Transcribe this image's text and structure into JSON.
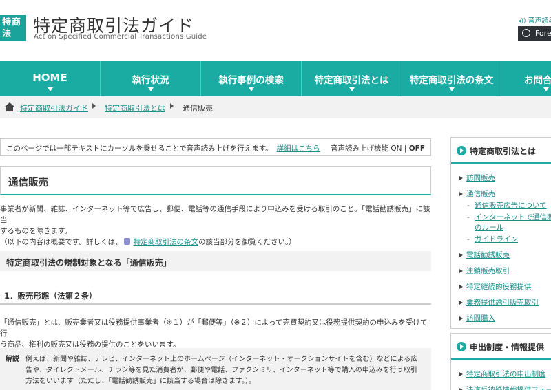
{
  "header": {
    "logo_line1": "特商",
    "logo_line2": "法",
    "title": "特定商取引法ガイド",
    "subtitle": "Act on Specified Commercial Transactions Guide",
    "audio_link": "音声読み",
    "foreign_label": "Fore"
  },
  "nav": {
    "items": [
      {
        "label": "HOME"
      },
      {
        "label": "執行状況"
      },
      {
        "label": "執行事例の検索"
      },
      {
        "label": "特定商取引法とは"
      },
      {
        "label": "特定商取引法の条文"
      },
      {
        "label": "お問合"
      }
    ]
  },
  "breadcrumb": {
    "link1": "特定商取引法ガイド",
    "link2": "特定商取引法とは",
    "current": "通信販売"
  },
  "speech": {
    "message": "このページでは一部テキストにカーソルを乗せることで音声読み上げを行えます。",
    "details_link": "詳細はこちら",
    "toggle_prefix": "音声読み上げ機能 ON",
    "toggle_sep": "|",
    "toggle_off": "OFF"
  },
  "main": {
    "title": "通信販売",
    "intro_line1": "事業者が新聞、雑誌、インターネット等で広告し、郵便、電話等の通信手段により申込みを受ける取引のこと。「電話勧誘販売」に該当",
    "intro_line2": "するものを除きます。",
    "intro_line3_pre": "（以下の内容は概要です。詳しくは、",
    "intro_link": "特定商取引法の条文",
    "intro_line3_post": "の該当部分を御覧ください。）",
    "section_heading": "特定商取引法の規制対象となる「通信販売」",
    "sub_heading": "1．販売形態（法第２条）",
    "para_line1": "「通信販売」とは、販売業者又は役務提供事業者（※１）が「郵便等」（※２）によって売買契約又は役務提供契約の申込みを受けて行",
    "para_line2": "う商品、権利の販売又は役務の提供のことをいいます。",
    "note_label": "解説",
    "note_line1": "例えば、新聞や雑誌、テレビ、インターネット上のホームページ（インターネット・オークションサイトを含む）などによる広",
    "note_line2": "告や、ダイレクトメール、チラシ等を見た消費者が、郵便や電話、ファクシミリ、インターネット等で購入の申込みを行う取引",
    "note_line3": "方法をいいます（ただし、「電話勧誘販売」に該当する場合は除きます。）。"
  },
  "sidebar": {
    "box1_title": "特定商取引法とは",
    "box1_items": [
      {
        "label": "訪問販売",
        "type": "main"
      },
      {
        "label": "通信販売",
        "type": "main"
      },
      {
        "label": "通信販売広告について",
        "type": "sub"
      },
      {
        "label": "インターネットで通信販売のルール",
        "type": "sub"
      },
      {
        "label": "ガイドライン",
        "type": "sub"
      },
      {
        "label": "電話勧誘販売",
        "type": "main"
      },
      {
        "label": "連鎖販売取引",
        "type": "main"
      },
      {
        "label": "特定継続的役務提供",
        "type": "main"
      },
      {
        "label": "業務提供誘引販売取引",
        "type": "main"
      },
      {
        "label": "訪問購入",
        "type": "main"
      }
    ],
    "box2_title": "申出制度・情報提供",
    "box2_items": [
      {
        "label": "特定商取引法の申出制度",
        "type": "main"
      },
      {
        "label": "法違反被疑情報提供フォー",
        "type": "main"
      }
    ]
  },
  "colors": {
    "accent": "#1aaca3",
    "link": "#1a8f8a",
    "nav_text": "#ffffff",
    "dark_button": "#2e3236"
  }
}
